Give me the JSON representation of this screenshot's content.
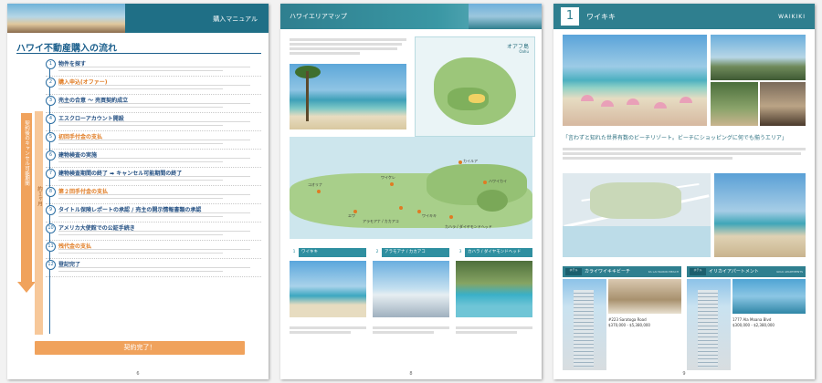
{
  "page1": {
    "header_title": "購入マニュアル",
    "title": "ハワイ不動産購入の流れ",
    "steps": [
      {
        "num": "1",
        "title": "物件を探す",
        "orange": false
      },
      {
        "num": "2",
        "title": "購入申込(オファー)",
        "orange": true
      },
      {
        "num": "3",
        "title": "売主の合意 ～ 売買契約成立",
        "orange": false
      },
      {
        "num": "4",
        "title": "エスクローアカウント開設",
        "orange": false
      },
      {
        "num": "5",
        "title": "初回手付金の支払",
        "orange": true
      },
      {
        "num": "6",
        "title": "建物検査の実施",
        "orange": false
      },
      {
        "num": "7",
        "title": "建物検査期間の終了 ➡ キャンセル可能期間の終了",
        "orange": false
      },
      {
        "num": "8",
        "title": "第２回手付金の支払",
        "orange": true
      },
      {
        "num": "9",
        "title": "タイトル保険レポートの承認 / 売主の開示情報書類の承認",
        "orange": false
      },
      {
        "num": "10",
        "title": "アメリカ大使館での公証手続き",
        "orange": false
      },
      {
        "num": "11",
        "title": "残代金の支払",
        "orange": true
      },
      {
        "num": "12",
        "title": "登記完了",
        "orange": false
      }
    ],
    "vtext1": "契約後のキャンセル可能期間",
    "vtext2": "約１ヶ月",
    "final_button": "契約完了！",
    "page_number": "6"
  },
  "page2": {
    "header_title": "ハワイエリアマップ",
    "island_title": "オアフ島",
    "island_sub": "Oahu",
    "map_labels": [
      "カイルア",
      "ハワイカイ",
      "コオリナ",
      "ワイケレ",
      "ワイキキ",
      "アラモアナ / カカアコ",
      "カハラ / ダイヤモンドヘッド",
      "エワ"
    ],
    "captions": [
      {
        "num": "1",
        "label": "ワイキキ"
      },
      {
        "num": "2",
        "label": "アラモアナ / カカアコ"
      },
      {
        "num": "3",
        "label": "カハラ / ダイヤモンドヘッド"
      }
    ],
    "page_number": "8"
  },
  "page3": {
    "number": "1",
    "title": "ワイキキ",
    "title_en": "WAIKIKI",
    "quote": "「言わずと知れた世界有数のビーチリゾート。ビーチにショッピングに何でも揃うエリア」",
    "hotels": [
      {
        "tag": "ホテル",
        "name": "カライワイキキビーチ",
        "name_en": "KA LAI WAIKIKI BEACH",
        "address": "#223 Saratoga Road",
        "price": "$370,000 - $5,380,000"
      },
      {
        "tag": "ホテル",
        "name": "イリカイアパートメント",
        "name_en": "ILIKAI APARTMENTS",
        "address": "1777 Ala Moana Blvd",
        "price": "$300,000 - $2,380,000"
      }
    ],
    "page_number": "9"
  }
}
